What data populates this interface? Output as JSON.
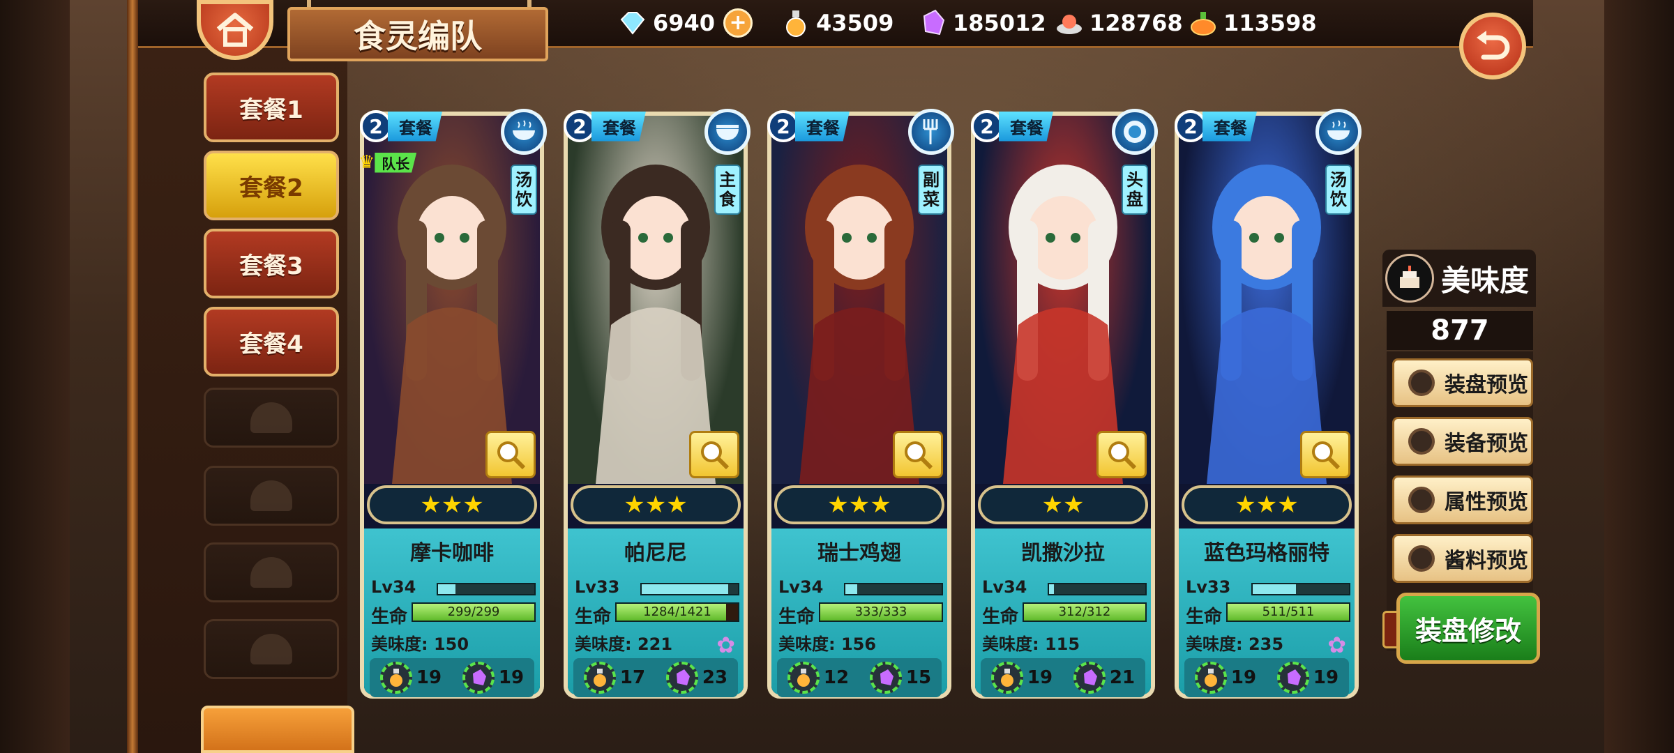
{
  "header": {
    "title": "食灵编队",
    "resources": [
      {
        "icon": "diamond-icon",
        "value": "6940",
        "color": "#8ee8ff"
      },
      {
        "icon": "oil-flask-icon",
        "value": "43509",
        "color": "#ffb43a"
      },
      {
        "icon": "crystal-icon",
        "value": "185012",
        "color": "#c86cff"
      },
      {
        "icon": "meat-dish-icon",
        "value": "128768",
        "color": "#ff7a5a"
      },
      {
        "icon": "orange-bowl-icon",
        "value": "113598",
        "color": "#ff8a2a"
      }
    ]
  },
  "sidebar": {
    "tabs": [
      {
        "label": "套餐1",
        "active": false
      },
      {
        "label": "套餐2",
        "active": true
      },
      {
        "label": "套餐3",
        "active": false
      },
      {
        "label": "套餐4",
        "active": false
      }
    ],
    "locked_count": 4
  },
  "cards": [
    {
      "set_num": "2",
      "set_label": "套餐",
      "type_tag": "汤饮",
      "type_icon": "soup-icon",
      "leader": "队长",
      "stars": "★★★",
      "name": "摩卡咖啡",
      "lv": "Lv34",
      "lv_pct": 0.18,
      "hp_label": "生命",
      "hp": "299/299",
      "hp_pct": 1.0,
      "taste": "美味度: 150",
      "item1": "19",
      "item2": "19",
      "flower": false,
      "art1": "#2a1b3a",
      "art2": "#8a4a2e",
      "hair": "#6b4a34"
    },
    {
      "set_num": "2",
      "set_label": "套餐",
      "type_tag": "主食",
      "type_icon": "bowl-icon",
      "leader": "",
      "stars": "★★★",
      "name": "帕尼尼",
      "lv": "Lv33",
      "lv_pct": 0.9,
      "hp_label": "生命",
      "hp": "1284/1421",
      "hp_pct": 0.9,
      "taste": "美味度: 221",
      "item1": "17",
      "item2": "23",
      "flower": true,
      "art1": "#2b3b2a",
      "art2": "#d8d0c2",
      "hair": "#3b2a22"
    },
    {
      "set_num": "2",
      "set_label": "套餐",
      "type_tag": "副菜",
      "type_icon": "fork-icon",
      "leader": "",
      "stars": "★★★",
      "name": "瑞士鸡翅",
      "lv": "Lv34",
      "lv_pct": 0.12,
      "hp_label": "生命",
      "hp": "333/333",
      "hp_pct": 1.0,
      "taste": "美味度: 156",
      "item1": "12",
      "item2": "15",
      "flower": false,
      "art1": "#1a2142",
      "art2": "#7a1d1d",
      "hair": "#8a3a20"
    },
    {
      "set_num": "2",
      "set_label": "套餐",
      "type_tag": "头盘",
      "type_icon": "plate-icon",
      "leader": "",
      "stars": "★★",
      "name": "凯撒沙拉",
      "lv": "Lv34",
      "lv_pct": 0.05,
      "hp_label": "生命",
      "hp": "312/312",
      "hp_pct": 1.0,
      "taste": "美味度: 115",
      "item1": "19",
      "item2": "21",
      "flower": false,
      "art1": "#101a3a",
      "art2": "#c8352a",
      "hair": "#f2eee8"
    },
    {
      "set_num": "2",
      "set_label": "套餐",
      "type_tag": "汤饮",
      "type_icon": "soup-icon",
      "leader": "",
      "stars": "★★★",
      "name": "蓝色玛格丽特",
      "lv": "Lv33",
      "lv_pct": 0.45,
      "hp_label": "生命",
      "hp": "511/511",
      "hp_pct": 1.0,
      "taste": "美味度: 235",
      "item1": "19",
      "item2": "19",
      "flower": true,
      "art1": "#10183a",
      "art2": "#3b6ad8",
      "hair": "#3b7ae0"
    }
  ],
  "panel": {
    "taste_label": "美味度",
    "taste_value": "877",
    "previews": [
      "装盘预览",
      "装备预览",
      "属性预览",
      "酱料预览"
    ],
    "modify": "装盘修改"
  }
}
